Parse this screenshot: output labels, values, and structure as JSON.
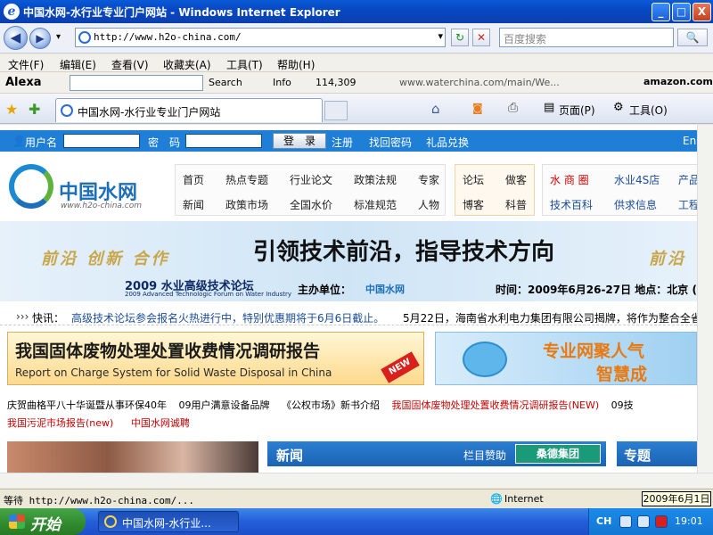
{
  "window": {
    "title": "中国水网-水行业专业门户网站 - Windows Internet Explorer",
    "minimize_label": "_",
    "maximize_label": "□",
    "close_label": "X"
  },
  "address_bar": {
    "url": "http://www.h2o-china.com/",
    "search_placeholder": "百度搜索",
    "dropdown_label": "▾",
    "refresh_label": "↻",
    "stop_label": "✕",
    "search_go_label": "🔍"
  },
  "menu": {
    "items": [
      "文件(F)",
      "编辑(E)",
      "查看(V)",
      "收藏夹(A)",
      "工具(T)",
      "帮助(H)"
    ]
  },
  "alexa_toolbar": {
    "brand": "Alexa",
    "search_label": "Search",
    "info_label": "Info",
    "rank": "114,309",
    "site": "www.waterchina.com/main/We...",
    "amazon": "amazon.com"
  },
  "tabs": {
    "active_label": "中国水网-水行业专业门户网站",
    "page_menu": "页面(P)",
    "tools_menu": "工具(O)"
  },
  "page": {
    "login": {
      "username_label": "用户名",
      "password_label": "密　码",
      "login_button": "登　录",
      "register": "注册",
      "find_password": "找回密码",
      "gift": "礼品兑换",
      "lang": "En"
    },
    "logo": {
      "name": "中国水网",
      "url": "www.h2o-china.com"
    },
    "nav_main": [
      [
        "首页",
        "热点专题",
        "行业论文",
        "政策法规",
        "专家"
      ],
      [
        "新闻",
        "政策市场",
        "全国水价",
        "标准规范",
        "人物"
      ]
    ],
    "nav_community": [
      [
        "论坛",
        "做客"
      ],
      [
        "博客",
        "科普"
      ]
    ],
    "nav_business": [
      [
        "水 商 圈",
        "水业4S店",
        "产品"
      ],
      [
        "技术百科",
        "供求信息",
        "工程"
      ]
    ],
    "banner": {
      "slogan_left": "前沿 创新 合作",
      "slogan_right": "前沿",
      "headline": "引领技术前沿，指导技术方向",
      "forum": "2009 水业高级技术论坛",
      "forum_en": "2009 Advanced Technologic Forum on Water Industry",
      "host_label": "主办单位：",
      "host_1": "中国水网",
      "date": "时间：2009年6月26-27日   地点：北京 ("
    },
    "news_ticker": {
      "label": "快讯：",
      "item_1": "高级技术论坛参会报名火热进行中，特别优惠期将于6月6日截止。",
      "item_2": "5月22日，海南省水利电力集团有限公司揭牌，将作为整合全省"
    },
    "ad_left": {
      "title": "我国固体废物处理处置收费情况调研报告",
      "subtitle": "Report on Charge System for Solid Waste Disposal in China",
      "badge": "NEW"
    },
    "ad_right": {
      "line_1": "专业网聚人气",
      "line_2": "智慧成"
    },
    "links_row_1": [
      "庆贺曲格平八十华诞暨从事环保40年",
      "09用户满意设备品牌",
      "《公权市场》新书介绍",
      "我国固体废物处理处置收费情况调研报告(NEW)",
      "09技"
    ],
    "links_row_2": [
      "我国污泥市场报告(new)",
      "中国水网诚聘"
    ],
    "news_section": {
      "title": "新闻",
      "sponsor_label": "栏目赞助",
      "sponsor": "桑德集团"
    },
    "topic_section": {
      "title": "专题"
    }
  },
  "status_bar": {
    "text": "等待 http://www.h2o-china.com/...",
    "zone": "Internet",
    "date_tooltip": "2009年6月1日"
  },
  "taskbar": {
    "start_label": "开始",
    "task_label": "中国水网-水行业...",
    "lang": "CH",
    "clock": "19:01"
  },
  "colors": {
    "login_bar": "#1f7fd6",
    "news_header": "#1b63b5",
    "accent_red": "#cc0000"
  }
}
